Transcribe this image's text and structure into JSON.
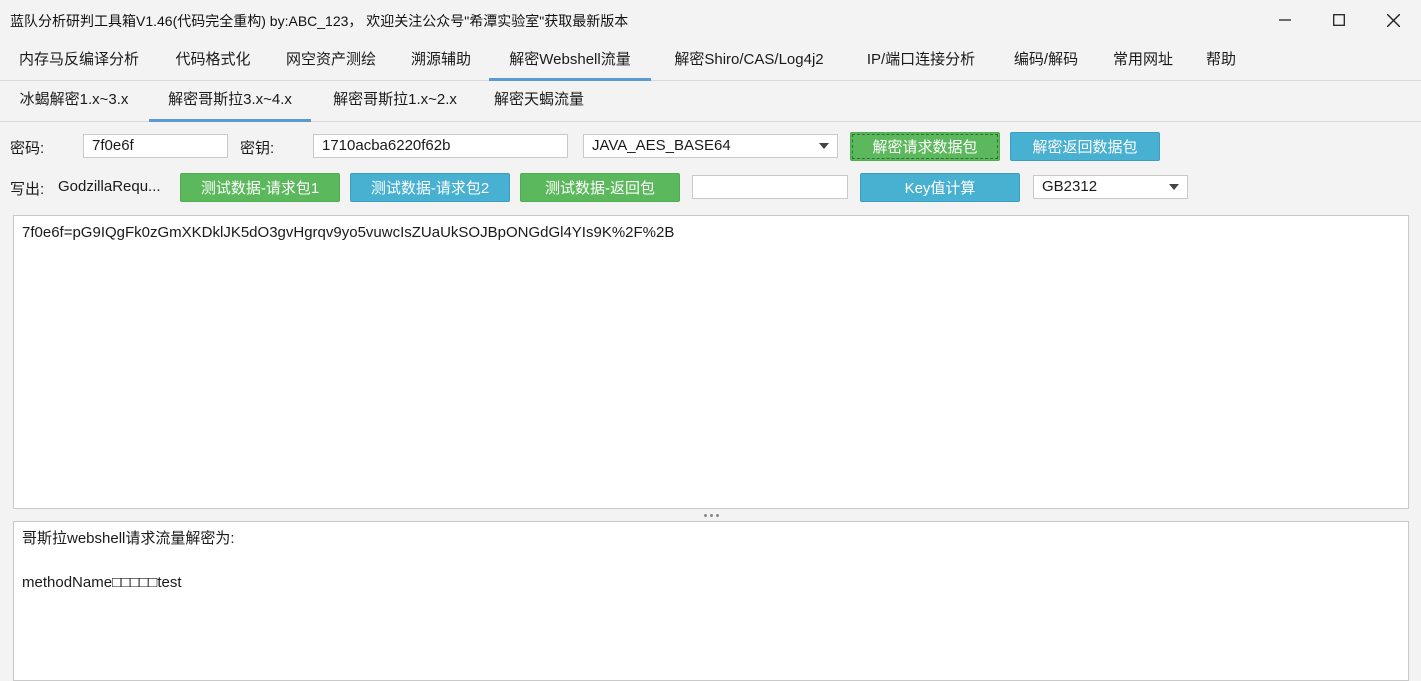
{
  "window": {
    "title": "蓝队分析研判工具箱V1.46(代码完全重构) by:ABC_123， 欢迎关注公众号\"希潭实验室\"获取最新版本"
  },
  "menu": {
    "tabs": [
      {
        "label": "内存马反编译分析"
      },
      {
        "label": "代码格式化"
      },
      {
        "label": "网空资产测绘"
      },
      {
        "label": "溯源辅助"
      },
      {
        "label": "解密Webshell流量"
      },
      {
        "label": "解密Shiro/CAS/Log4j2"
      },
      {
        "label": "IP/端口连接分析"
      },
      {
        "label": "编码/解码"
      },
      {
        "label": "常用网址"
      },
      {
        "label": "帮助"
      }
    ],
    "active_index": 4
  },
  "subtabs": {
    "tabs": [
      {
        "label": "冰蝎解密1.x~3.x"
      },
      {
        "label": "解密哥斯拉3.x~4.x"
      },
      {
        "label": "解密哥斯拉1.x~2.x"
      },
      {
        "label": "解密天蝎流量"
      }
    ],
    "active_index": 1
  },
  "form": {
    "password_label": "密码:",
    "password_value": "7f0e6f",
    "key_label": "密钥:",
    "key_value": "1710acba6220f62b",
    "crypto_select": "JAVA_AES_BASE64",
    "decrypt_request_button": "解密请求数据包",
    "decrypt_response_button": "解密返回数据包",
    "writeout_label": "写出:",
    "writeout_value": "GodzillaRequ...",
    "test_request1_button": "测试数据-请求包1",
    "test_request2_button": "测试数据-请求包2",
    "test_response_button": "测试数据-返回包",
    "key_input_value": "",
    "key_calc_button": "Key值计算",
    "charset_select": "GB2312"
  },
  "input_area": {
    "text": "7f0e6f=pG9IQgFk0zGmXKDklJK5dO3gvHgrqv9yo5vuwcIsZUaUkSOJBpONGdGl4YIs9K%2F%2B"
  },
  "output_area": {
    "text": "哥斯拉webshell请求流量解密为:\n\nmethodName□□□□□test"
  },
  "colors": {
    "accent": "#5b9bd5",
    "green_button": "#5cb85c",
    "blue_button": "#48b0d0"
  }
}
